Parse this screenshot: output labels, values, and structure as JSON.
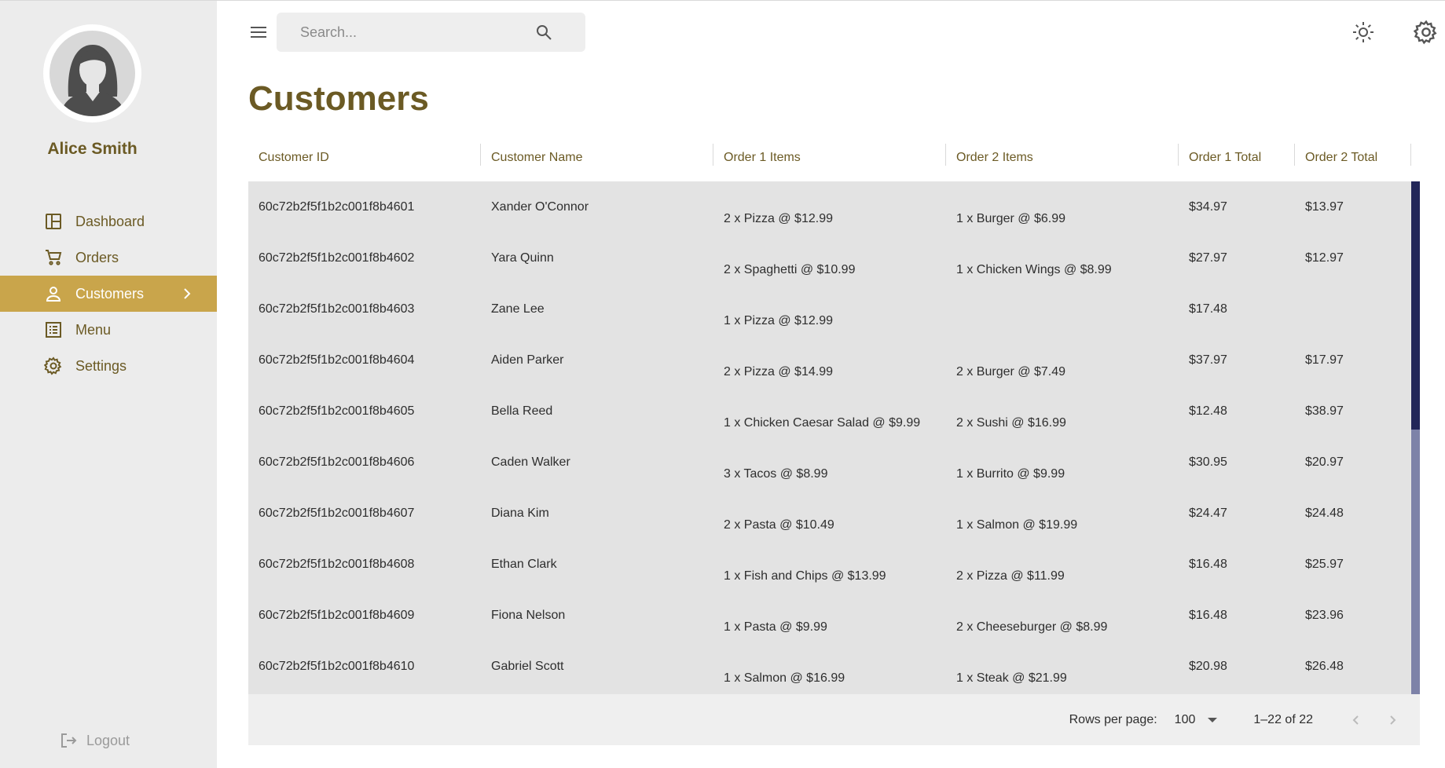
{
  "user": {
    "name": "Alice Smith"
  },
  "search": {
    "placeholder": "Search..."
  },
  "page": {
    "title": "Customers"
  },
  "nav": [
    {
      "label": "Dashboard",
      "icon": "dashboard-icon"
    },
    {
      "label": "Orders",
      "icon": "cart-icon"
    },
    {
      "label": "Customers",
      "icon": "person-icon",
      "active": true
    },
    {
      "label": "Menu",
      "icon": "list-icon"
    },
    {
      "label": "Settings",
      "icon": "gear-icon"
    }
  ],
  "logout": {
    "label": "Logout"
  },
  "colors": {
    "accent": "#c9a54b",
    "brand_text": "#6b5a24",
    "scroll_thumb": "#222658"
  },
  "table": {
    "columns": [
      "Customer ID",
      "Customer Name",
      "Order 1 Items",
      "Order 2 Items",
      "Order 1 Total",
      "Order 2 Total"
    ],
    "rows": [
      [
        "60c72b2f5f1b2c001f8b4601",
        "Xander O'Connor",
        "2 x Pizza @ $12.99",
        "1 x Burger @ $6.99",
        "$34.97",
        "$13.97"
      ],
      [
        "60c72b2f5f1b2c001f8b4602",
        "Yara Quinn",
        "2 x Spaghetti @ $10.99",
        "1 x Chicken Wings @ $8.99",
        "$27.97",
        "$12.97"
      ],
      [
        "60c72b2f5f1b2c001f8b4603",
        "Zane Lee",
        "1 x Pizza @ $12.99",
        "",
        "$17.48",
        ""
      ],
      [
        "60c72b2f5f1b2c001f8b4604",
        "Aiden Parker",
        "2 x Pizza @ $14.99",
        "2 x Burger @ $7.49",
        "$37.97",
        "$17.97"
      ],
      [
        "60c72b2f5f1b2c001f8b4605",
        "Bella Reed",
        "1 x Chicken Caesar Salad @ $9.99",
        "2 x Sushi @ $16.99",
        "$12.48",
        "$38.97"
      ],
      [
        "60c72b2f5f1b2c001f8b4606",
        "Caden Walker",
        "3 x Tacos @ $8.99",
        "1 x Burrito @ $9.99",
        "$30.95",
        "$20.97"
      ],
      [
        "60c72b2f5f1b2c001f8b4607",
        "Diana Kim",
        "2 x Pasta @ $10.49",
        "1 x Salmon @ $19.99",
        "$24.47",
        "$24.48"
      ],
      [
        "60c72b2f5f1b2c001f8b4608",
        "Ethan Clark",
        "1 x Fish and Chips @ $13.99",
        "2 x Pizza @ $11.99",
        "$16.48",
        "$25.97"
      ],
      [
        "60c72b2f5f1b2c001f8b4609",
        "Fiona Nelson",
        "1 x Pasta @ $9.99",
        "2 x Cheeseburger @ $8.99",
        "$16.48",
        "$23.96"
      ],
      [
        "60c72b2f5f1b2c001f8b4610",
        "Gabriel Scott",
        "1 x Salmon @ $16.99",
        "1 x Steak @ $21.99",
        "$20.98",
        "$26.48"
      ]
    ]
  },
  "pagination": {
    "rows_per_page_label": "Rows per page:",
    "rows_per_page_value": "100",
    "range": "1–22 of 22"
  }
}
